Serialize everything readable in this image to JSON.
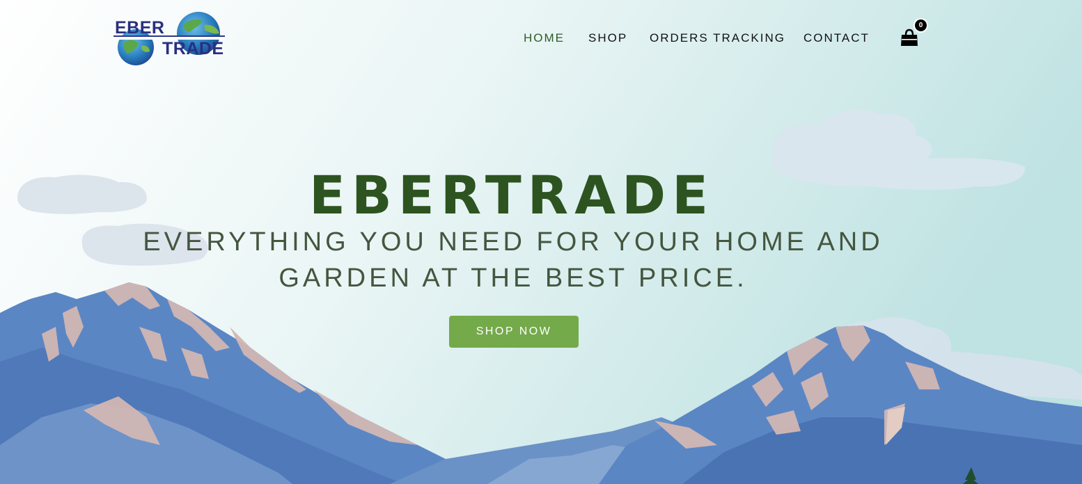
{
  "brand": {
    "logo_text_top": "EBER",
    "logo_text_bottom": "TRADE",
    "primary_color": "#2d5420",
    "accent_color": "#74aa4a"
  },
  "nav": {
    "items": [
      {
        "label": "HOME",
        "active": true
      },
      {
        "label": "SHOP",
        "active": false
      },
      {
        "label": "ORDERS TRACKING",
        "active": false
      },
      {
        "label": "CONTACT",
        "active": false
      }
    ]
  },
  "cart": {
    "icon": "shopping-bag-icon",
    "count": "0"
  },
  "hero": {
    "title": "EBERTRADE",
    "subtitle": "EVERYTHING YOU NEED FOR YOUR HOME AND GARDEN AT THE BEST PRICE.",
    "cta_label": "SHOP NOW"
  }
}
